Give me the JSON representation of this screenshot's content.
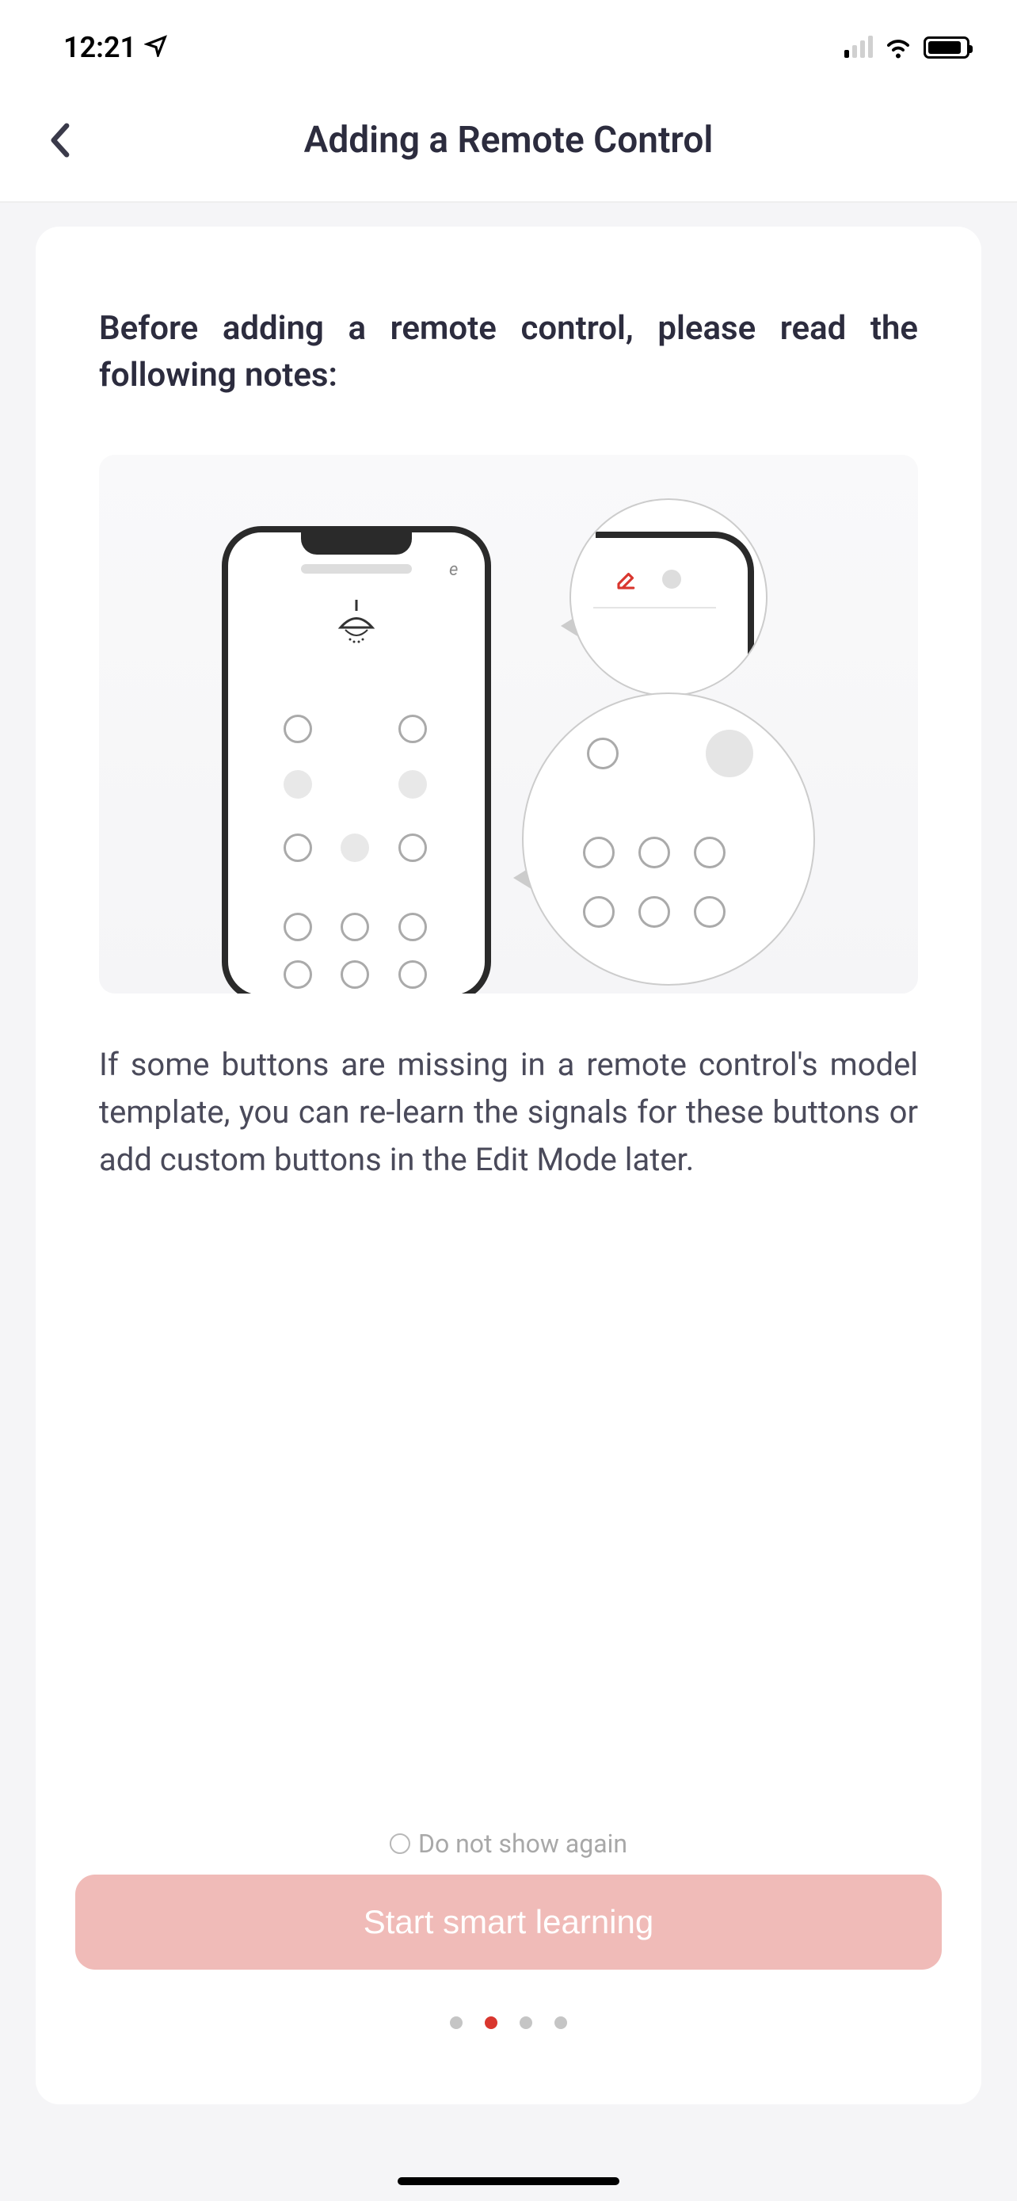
{
  "status_bar": {
    "time": "12:21"
  },
  "header": {
    "title": "Adding a Remote Control"
  },
  "content": {
    "intro": "Before adding a remote control, please read the following notes:",
    "body": "If some buttons are missing in a remote control's model template, you can re-learn the signals for these buttons or add custom buttons in the Edit Mode later."
  },
  "checkbox": {
    "label": "Do not show again"
  },
  "button": {
    "primary": "Start smart learning"
  },
  "pagination": {
    "total": 4,
    "active": 1
  }
}
